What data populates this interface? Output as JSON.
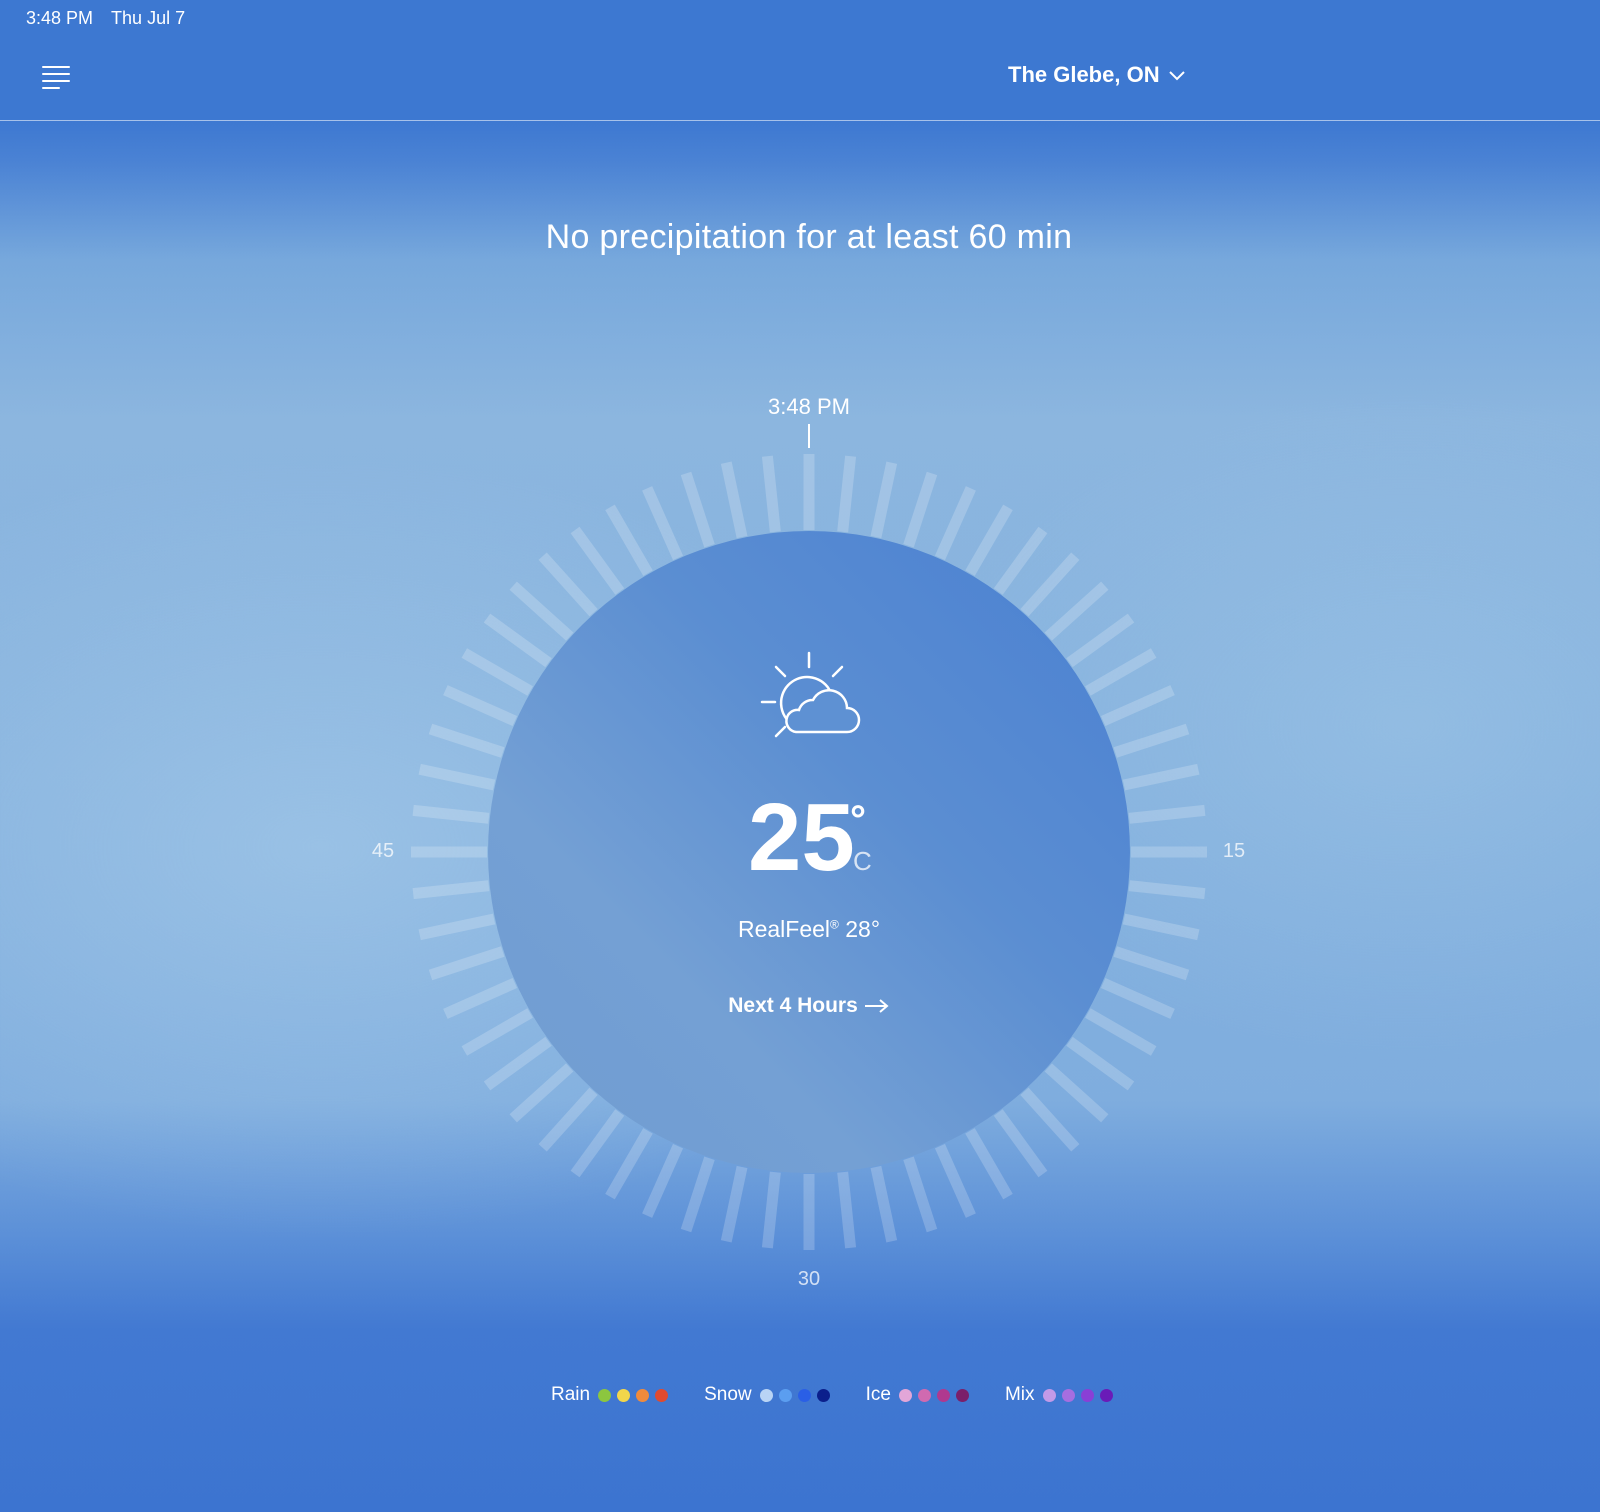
{
  "status_bar": {
    "time": "3:48 PM",
    "date": "Thu Jul 7"
  },
  "header": {
    "location": "The Glebe, ON"
  },
  "minutecast": {
    "headline": "No precipitation for at least 60 min",
    "now_label": "3:48 PM",
    "axis_labels": {
      "right": "15",
      "bottom": "30",
      "left": "45"
    }
  },
  "current": {
    "icon": "partly-sunny-icon",
    "temperature": "25",
    "degree_symbol": "°",
    "unit": "C",
    "realfeel_label": "RealFeel",
    "realfeel_mark": "®",
    "realfeel_value": "28°",
    "next_link": "Next 4 Hours"
  },
  "legend": [
    {
      "label": "Rain",
      "colors": [
        "#8cc63f",
        "#f2d64b",
        "#f08a3c",
        "#e04a2f"
      ]
    },
    {
      "label": "Snow",
      "colors": [
        "#b9d4f5",
        "#5b9ef0",
        "#2a5fe6",
        "#0b1f8c"
      ]
    },
    {
      "label": "Ice",
      "colors": [
        "#e2a6d8",
        "#d06ab0",
        "#b0398f",
        "#7a1f6a"
      ]
    },
    {
      "label": "Mix",
      "colors": [
        "#c39ae8",
        "#a66ee0",
        "#8a3fd6",
        "#6a1bb8"
      ]
    }
  ]
}
